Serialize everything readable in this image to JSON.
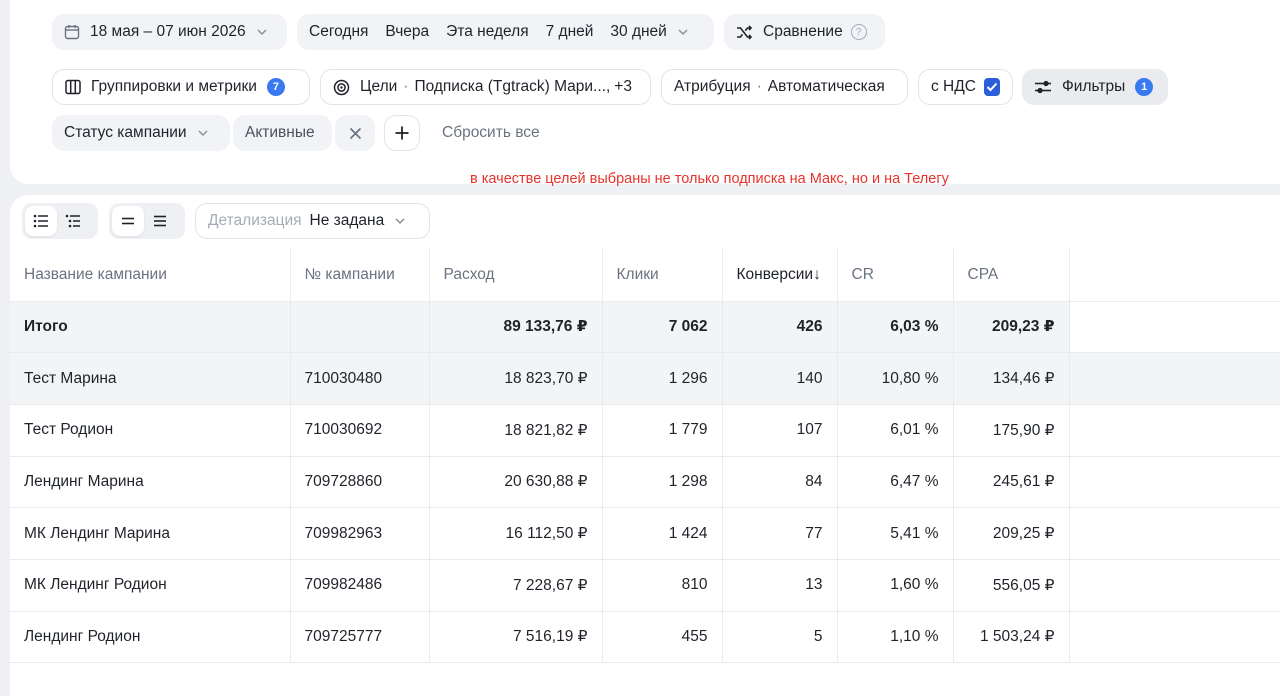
{
  "filters": {
    "date_range": "18 мая – 07 июн 2026",
    "periods": [
      "Сегодня",
      "Вчера",
      "Эта неделя",
      "7 дней",
      "30 дней"
    ],
    "compare_label": "Сравнение",
    "groupings_label": "Группировки и метрики",
    "groupings_count": "7",
    "goals_label": "Цели",
    "goals_value": "Подписка (Tgtrack) Мари...,",
    "goals_more": "+3",
    "attribution_label": "Атрибуция",
    "attribution_value": "Автоматическая",
    "vat_label": "с НДС",
    "vat_checked": true,
    "filters_label": "Фильтры",
    "filters_count": "1",
    "status_label": "Статус кампании",
    "status_value": "Активные",
    "reset_label": "Сбросить все"
  },
  "annotation": "в качестве целей выбраны не только подписка на Макс, но и на Телегу",
  "toolbar": {
    "detail_label": "Детализация",
    "detail_value": "Не задана"
  },
  "table": {
    "columns": [
      "Название кампании",
      "№ кампании",
      "Расход",
      "Клики",
      "Конверсии↓",
      "CR",
      "CPA"
    ],
    "total": {
      "name": "Итого",
      "id": "",
      "spend": "89 133,76 ₽",
      "clicks": "7 062",
      "conversions": "426",
      "cr": "6,03 %",
      "cpa": "209,23 ₽"
    },
    "rows": [
      {
        "name": "Тест Марина",
        "id": "710030480",
        "spend": "18 823,70 ₽",
        "clicks": "1 296",
        "conversions": "140",
        "cr": "10,80 %",
        "cpa": "134,46 ₽"
      },
      {
        "name": "Тест Родион",
        "id": "710030692",
        "spend": "18 821,82 ₽",
        "clicks": "1 779",
        "conversions": "107",
        "cr": "6,01 %",
        "cpa": "175,90 ₽"
      },
      {
        "name": "Лендинг Марина",
        "id": "709728860",
        "spend": "20 630,88 ₽",
        "clicks": "1 298",
        "conversions": "84",
        "cr": "6,47 %",
        "cpa": "245,61 ₽"
      },
      {
        "name": "МК Лендинг Марина",
        "id": "709982963",
        "spend": "16 112,50 ₽",
        "clicks": "1 424",
        "conversions": "77",
        "cr": "5,41 %",
        "cpa": "209,25 ₽"
      },
      {
        "name": "МК Лендинг Родион",
        "id": "709982486",
        "spend": "7 228,67 ₽",
        "clicks": "810",
        "conversions": "13",
        "cr": "1,60 %",
        "cpa": "556,05 ₽"
      },
      {
        "name": "Лендинг Родион",
        "id": "709725777",
        "spend": "7 516,19 ₽",
        "clicks": "455",
        "conversions": "5",
        "cr": "1,10 %",
        "cpa": "1 503,24 ₽"
      }
    ]
  },
  "colors": {
    "accent": "#3a7af0",
    "annotation": "#e8332b",
    "checkbox": "#2b5fd9"
  }
}
